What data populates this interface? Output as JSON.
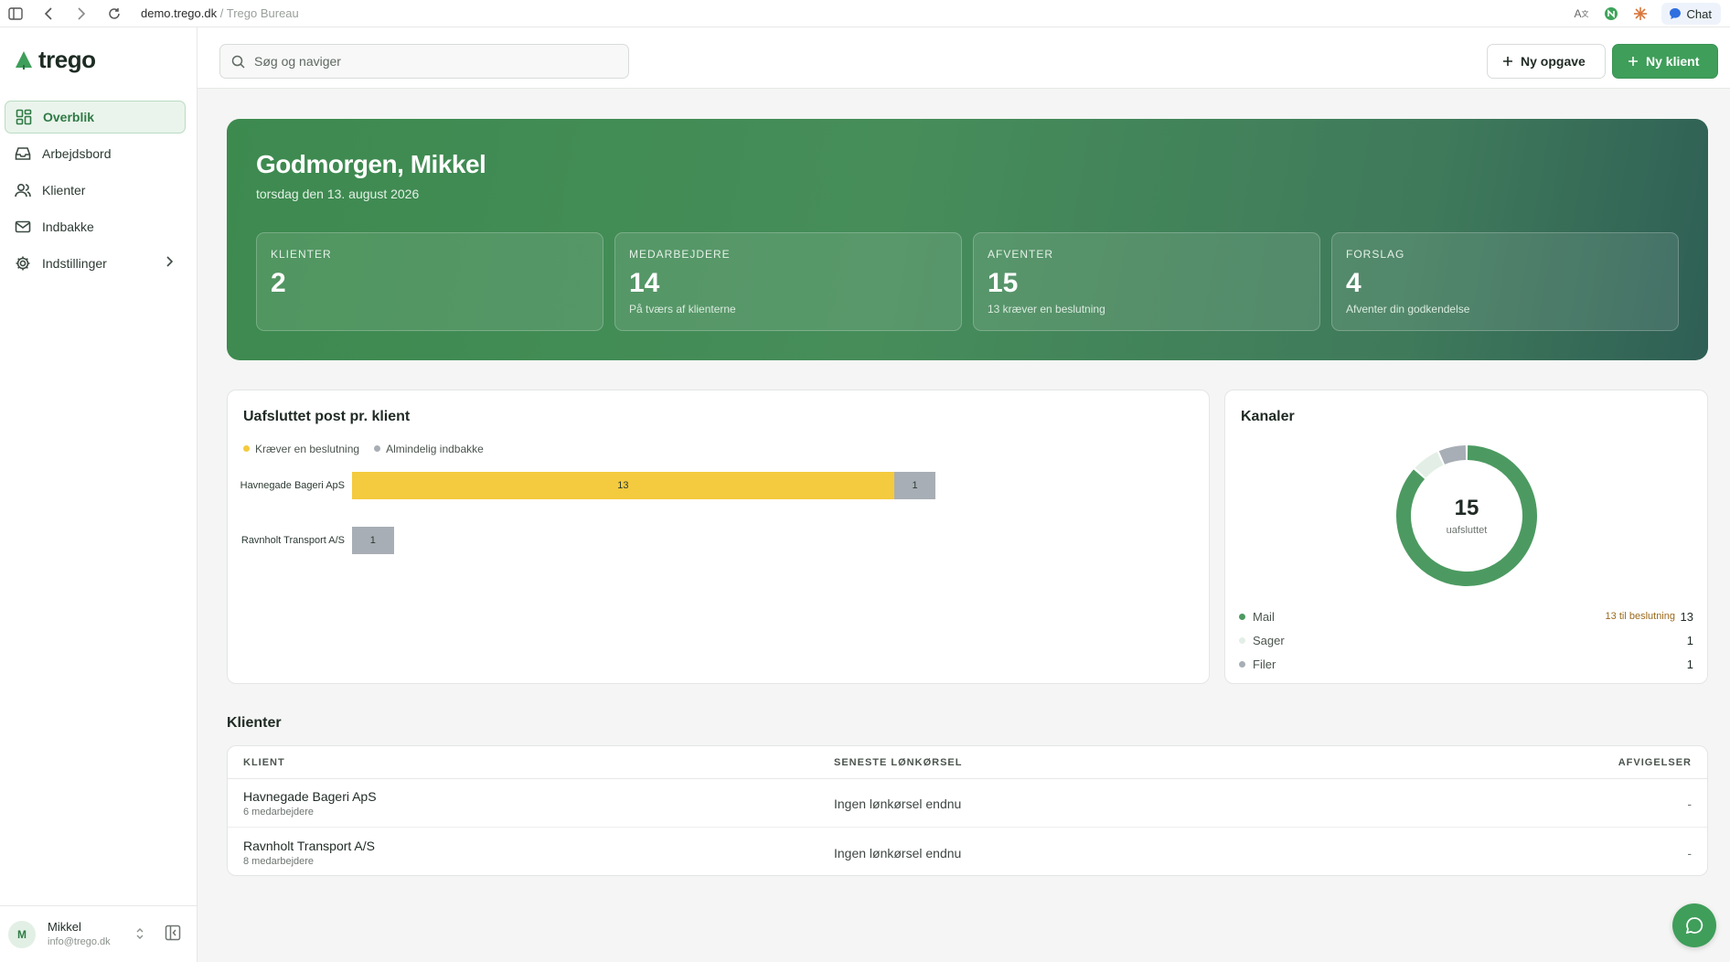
{
  "browser": {
    "domain": "demo.trego.dk",
    "separator": "/",
    "page_title": "Trego Bureau",
    "chat_label": "Chat"
  },
  "sidebar": {
    "logo": "trego",
    "items": [
      {
        "label": "Overblik",
        "icon": "grid-icon",
        "active": true
      },
      {
        "label": "Arbejdsbord",
        "icon": "inbox-tray-icon"
      },
      {
        "label": "Klienter",
        "icon": "users-icon"
      },
      {
        "label": "Indbakke",
        "icon": "mail-icon"
      },
      {
        "label": "Indstillinger",
        "icon": "gear-icon"
      }
    ],
    "user": {
      "initial": "M",
      "name": "Mikkel",
      "email": "info@trego.dk"
    }
  },
  "topbar": {
    "search_placeholder": "Søg og naviger",
    "new_task": "Ny opgave",
    "new_client": "Ny klient"
  },
  "hero": {
    "greeting": "Godmorgen, Mikkel",
    "date": "torsdag den 13. august 2026",
    "stats": [
      {
        "label": "KLIENTER",
        "value": "2",
        "sub": ""
      },
      {
        "label": "MEDARBEJDERE",
        "value": "14",
        "sub": "På tværs af klienterne"
      },
      {
        "label": "AFVENTER",
        "value": "15",
        "sub": "13 kræver en beslutning"
      },
      {
        "label": "FORSLAG",
        "value": "4",
        "sub": "Afventer din godkendelse"
      }
    ]
  },
  "bars_card": {
    "title": "Uafsluttet post pr. klient",
    "legend": [
      "Kræver en beslutning",
      "Almindelig indbakke"
    ],
    "colors": {
      "decision": "#f4ca3e",
      "inbox": "#a8aeb5"
    }
  },
  "chart_data": [
    {
      "type": "bar",
      "orientation": "horizontal",
      "stacked": true,
      "title": "Uafsluttet post pr. klient",
      "categories": [
        "Havnegade Bageri ApS",
        "Ravnholt Transport A/S"
      ],
      "series": [
        {
          "name": "Kræver en beslutning",
          "values": [
            13,
            0
          ]
        },
        {
          "name": "Almindelig indbakke",
          "values": [
            1,
            1
          ]
        }
      ],
      "xlim": [
        0,
        14
      ]
    },
    {
      "type": "pie",
      "title": "Kanaler",
      "center_value": "15",
      "center_label": "uafsluttet",
      "categories": [
        "Mail",
        "Sager",
        "Filer"
      ],
      "values": [
        13,
        1,
        1
      ],
      "colors": [
        "#4c9a61",
        "#e3efe6",
        "#a8aeb5"
      ]
    }
  ],
  "kanaler": {
    "title": "Kanaler",
    "rows": [
      {
        "label": "Mail",
        "note": "13 til beslutning",
        "value": "13"
      },
      {
        "label": "Sager",
        "note": "",
        "value": "1"
      },
      {
        "label": "Filer",
        "note": "",
        "value": "1"
      }
    ]
  },
  "clients": {
    "title": "Klienter",
    "columns": [
      "KLIENT",
      "SENESTE LØNKØRSEL",
      "AFVIGELSER"
    ],
    "rows": [
      {
        "name": "Havnegade Bageri ApS",
        "employees": "6 medarbejdere",
        "last_run": "Ingen lønkørsel endnu",
        "deviations": "-"
      },
      {
        "name": "Ravnholt Transport A/S",
        "employees": "8 medarbejdere",
        "last_run": "Ingen lønkørsel endnu",
        "deviations": "-"
      }
    ]
  }
}
